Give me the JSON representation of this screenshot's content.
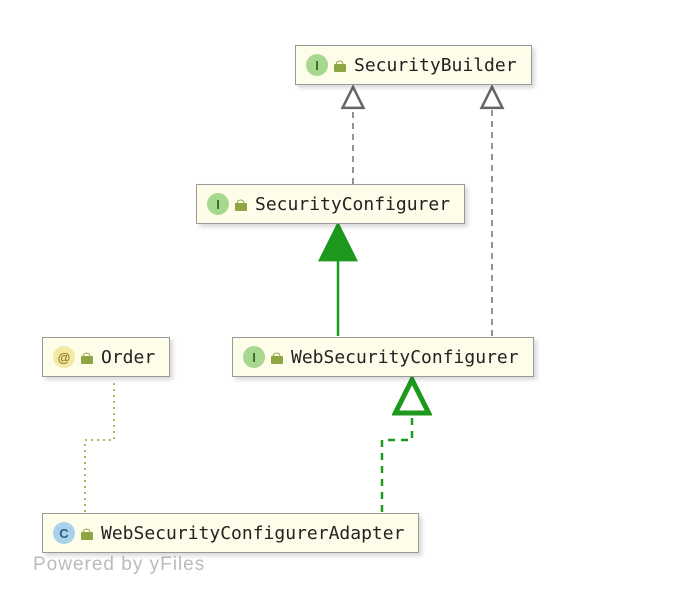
{
  "nodes": {
    "securityBuilder": {
      "kind": "I",
      "label": "SecurityBuilder"
    },
    "securityConfigurer": {
      "kind": "I",
      "label": "SecurityConfigurer"
    },
    "order": {
      "kind": "@",
      "label": "Order"
    },
    "webSecurityConfigurer": {
      "kind": "I",
      "label": "WebSecurityConfigurer"
    },
    "webSecurityConfigurerAdapter": {
      "kind": "C",
      "label": "WebSecurityConfigurerAdapter"
    }
  },
  "footer": {
    "credit": "Powered by yFiles"
  }
}
